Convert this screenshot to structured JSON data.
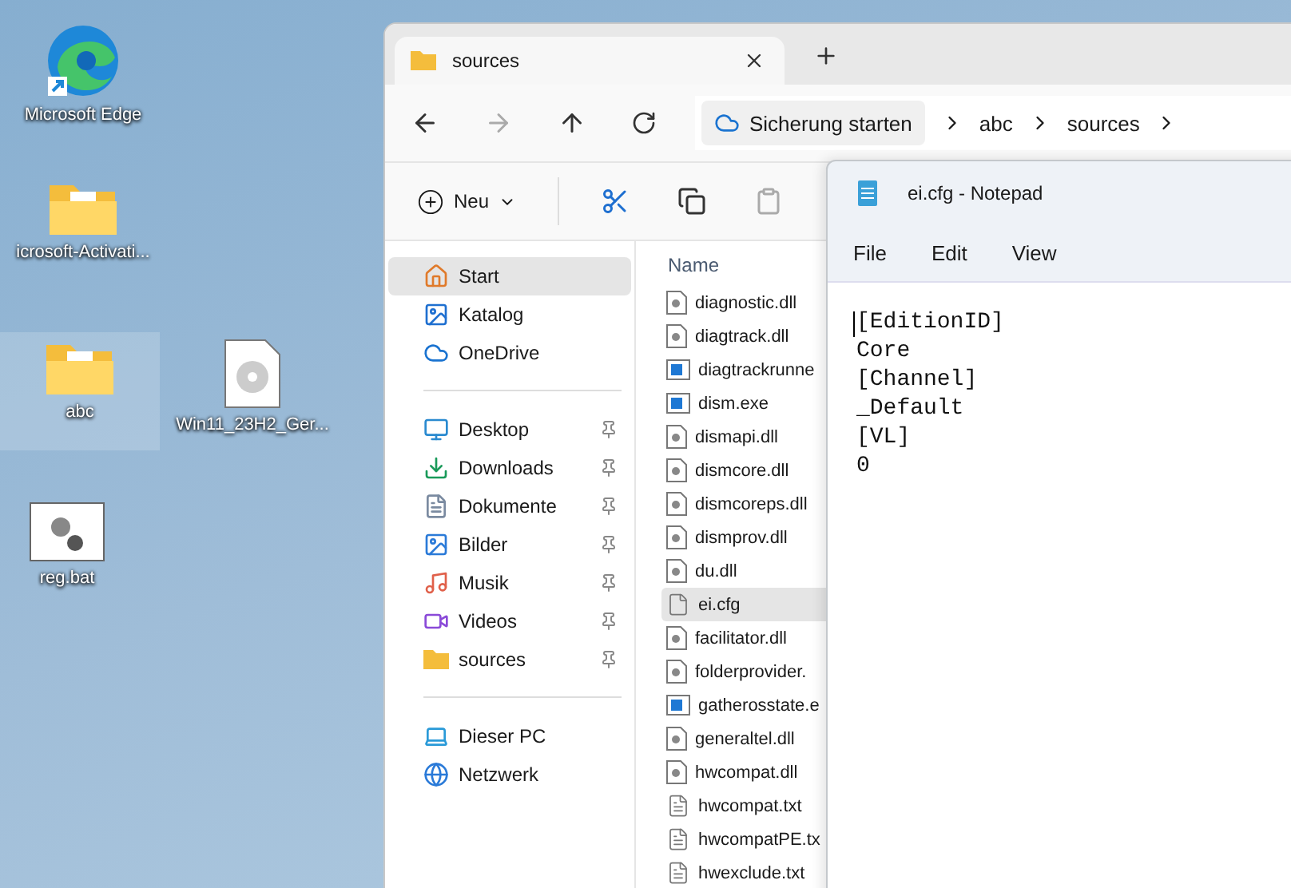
{
  "desktop": {
    "icons": [
      {
        "label": "Microsoft Edge",
        "kind": "browser",
        "selected": false
      },
      {
        "label": "icrosoft-Activati...",
        "kind": "folder",
        "selected": false
      },
      {
        "label": "abc",
        "kind": "folder",
        "selected": true
      },
      {
        "label": "Win11_23H2_Ger...",
        "kind": "disc",
        "selected": false
      },
      {
        "label": "reg.bat",
        "kind": "batch",
        "selected": false
      }
    ]
  },
  "explorer": {
    "tab": {
      "title": "sources"
    },
    "address": {
      "backup": "Sicherung starten",
      "path": [
        "abc",
        "sources"
      ]
    },
    "toolbar": {
      "new": "Neu"
    },
    "sidebar": {
      "groups": [
        [
          {
            "label": "Start",
            "kind": "home",
            "pinned": false,
            "selected": true
          },
          {
            "label": "Katalog",
            "kind": "gallery",
            "pinned": false,
            "selected": false
          },
          {
            "label": "OneDrive",
            "kind": "cloud",
            "pinned": false,
            "selected": false
          }
        ],
        [
          {
            "label": "Desktop",
            "kind": "desktop",
            "pinned": true,
            "selected": false
          },
          {
            "label": "Downloads",
            "kind": "download",
            "pinned": true,
            "selected": false
          },
          {
            "label": "Dokumente",
            "kind": "document",
            "pinned": true,
            "selected": false
          },
          {
            "label": "Bilder",
            "kind": "pictures",
            "pinned": true,
            "selected": false
          },
          {
            "label": "Musik",
            "kind": "music",
            "pinned": true,
            "selected": false
          },
          {
            "label": "Videos",
            "kind": "videos",
            "pinned": true,
            "selected": false
          },
          {
            "label": "sources",
            "kind": "folder",
            "pinned": true,
            "selected": false
          }
        ],
        [
          {
            "label": "Dieser PC",
            "kind": "pc",
            "pinned": false,
            "selected": false
          },
          {
            "label": "Netzwerk",
            "kind": "network",
            "pinned": false,
            "selected": false
          }
        ]
      ]
    },
    "files": {
      "column": "Name",
      "rows": [
        {
          "name": "diagnostic.dll",
          "kind": "dll",
          "selected": false
        },
        {
          "name": "diagtrack.dll",
          "kind": "dll",
          "selected": false
        },
        {
          "name": "diagtrackrunne",
          "kind": "exe",
          "selected": false
        },
        {
          "name": "dism.exe",
          "kind": "exe",
          "selected": false
        },
        {
          "name": "dismapi.dll",
          "kind": "dll",
          "selected": false
        },
        {
          "name": "dismcore.dll",
          "kind": "dll",
          "selected": false
        },
        {
          "name": "dismcoreps.dll",
          "kind": "dll",
          "selected": false
        },
        {
          "name": "dismprov.dll",
          "kind": "dll",
          "selected": false
        },
        {
          "name": "du.dll",
          "kind": "dll",
          "selected": false
        },
        {
          "name": "ei.cfg",
          "kind": "blank",
          "selected": true
        },
        {
          "name": "facilitator.dll",
          "kind": "dll",
          "selected": false
        },
        {
          "name": "folderprovider.",
          "kind": "dll",
          "selected": false
        },
        {
          "name": "gatherosstate.e",
          "kind": "exe",
          "selected": false
        },
        {
          "name": "generaltel.dll",
          "kind": "dll",
          "selected": false
        },
        {
          "name": "hwcompat.dll",
          "kind": "dll",
          "selected": false
        },
        {
          "name": "hwcompat.txt",
          "kind": "txt",
          "selected": false
        },
        {
          "name": "hwcompatPE.tx",
          "kind": "txt",
          "selected": false
        },
        {
          "name": "hwexclude.txt",
          "kind": "txt",
          "selected": false
        }
      ]
    }
  },
  "notepad": {
    "title": "ei.cfg - Notepad",
    "menu": [
      "File",
      "Edit",
      "View"
    ],
    "lines": [
      "[EditionID]",
      "Core",
      "[Channel]",
      "_Default",
      "[VL]",
      "0"
    ]
  }
}
